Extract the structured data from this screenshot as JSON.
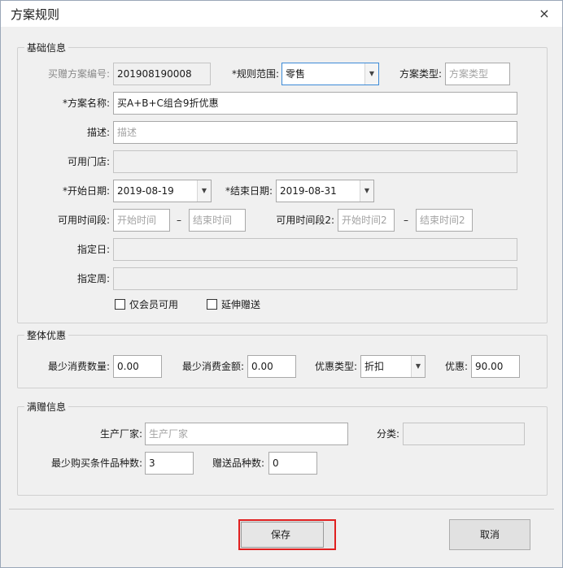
{
  "window": {
    "title": "方案规则",
    "close": "×"
  },
  "basic": {
    "legend": "基础信息",
    "code_label": "买赠方案编号:",
    "code_value": "201908190008",
    "scope_label": "*规则范围:",
    "scope_value": "零售",
    "type_label": "方案类型:",
    "type_placeholder": "方案类型",
    "name_label": "*方案名称:",
    "name_value": "买A+B+C组合9折优惠",
    "desc_label": "描述:",
    "desc_placeholder": "描述",
    "store_label": "可用门店:",
    "start_label": "*开始日期:",
    "start_value": "2019-08-19",
    "end_label": "*结束日期:",
    "end_value": "2019-08-31",
    "period1_label": "可用时间段:",
    "period1_start_placeholder": "开始时间",
    "period1_end_placeholder": "结束时间",
    "period2_label": "可用时间段2:",
    "period2_start_placeholder": "开始时间2",
    "period2_end_placeholder": "结束时间2",
    "dash": "–",
    "day_label": "指定日:",
    "week_label": "指定周:",
    "member_only": "仅会员可用",
    "extend_gift": "延伸赠送"
  },
  "overall": {
    "legend": "整体优惠",
    "min_qty_label": "最少消费数量:",
    "min_qty_value": "0.00",
    "min_amount_label": "最少消费金额:",
    "min_amount_value": "0.00",
    "disc_type_label": "优惠类型:",
    "disc_type_value": "折扣",
    "disc_label": "优惠:",
    "disc_value": "90.00"
  },
  "gift": {
    "legend": "满赠信息",
    "maker_label": "生产厂家:",
    "maker_placeholder": "生产厂家",
    "category_label": "分类:",
    "min_kinds_label": "最少购买条件品种数:",
    "min_kinds_value": "3",
    "gift_kinds_label": "赠送品种数:",
    "gift_kinds_value": "0"
  },
  "actions": {
    "save": "保存",
    "cancel": "取消"
  },
  "colors": {
    "save_highlight": "#e02020",
    "focus_border": "#3c8ad7"
  },
  "icons": {
    "dropdown": "chevron-down-icon",
    "close": "close-icon"
  }
}
